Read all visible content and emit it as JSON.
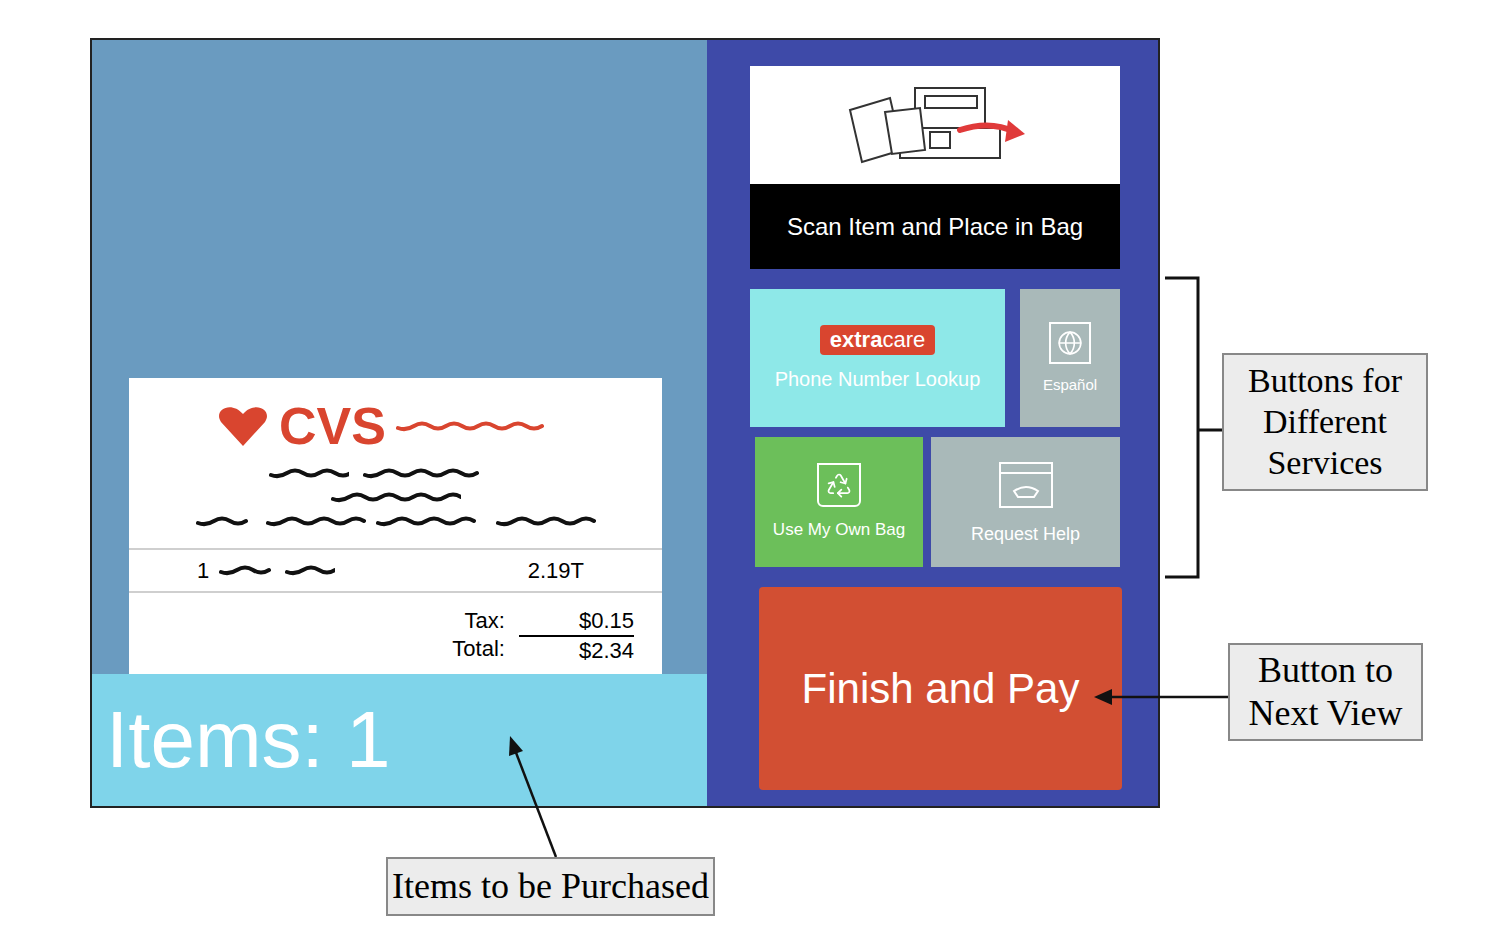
{
  "screen": {
    "receipt": {
      "logo": "CVS",
      "line_items": [
        {
          "qty": "1",
          "price": "2.19T"
        }
      ],
      "tax_label": "Tax:",
      "tax": "$0.15",
      "total_label": "Total:",
      "total": "$2.34"
    },
    "item_count": "Items: 1",
    "scan_prompt": "Scan Item and Place in Bag",
    "services": [
      {
        "kind": "extracare",
        "label": "Phone Number Lookup",
        "badge": {
          "bold": "extra",
          "light": "care"
        },
        "color": "#8ee8e8"
      },
      {
        "kind": "language",
        "label": "Español",
        "color": "#a9b9b9"
      },
      {
        "kind": "bag",
        "label": "Use My Own Bag",
        "color": "#6cbf5a"
      },
      {
        "kind": "help",
        "label": "Request Help",
        "color": "#a9b9b9"
      }
    ],
    "finish_button": "Finish and Pay"
  },
  "annotations": [
    {
      "label": "Buttons for Different Services"
    },
    {
      "label": "Button to Next View"
    },
    {
      "label": "Items to be Purchased"
    }
  ]
}
